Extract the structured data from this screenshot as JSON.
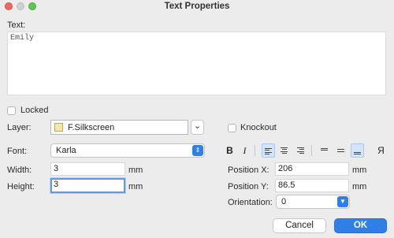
{
  "window": {
    "title": "Text Properties"
  },
  "text_section": {
    "label": "Text:",
    "value": "Emily"
  },
  "locked": {
    "label": "Locked",
    "checked": false
  },
  "layer": {
    "label": "Layer:",
    "value": "F.Silkscreen",
    "swatch_color": "#f5e7a6"
  },
  "knockout": {
    "label": "Knockout",
    "checked": false
  },
  "font": {
    "label": "Font:",
    "value": "Karla"
  },
  "format_toolbar": {
    "bold": "B",
    "italic": "I",
    "mirror": "Я",
    "icons": [
      "align-left-icon",
      "align-center-icon",
      "align-right-icon",
      "valign-top-icon",
      "valign-middle-icon",
      "valign-bottom-icon"
    ],
    "active": [
      "align-left",
      "valign-bottom"
    ],
    "accent_color": "#d3e5fb"
  },
  "width": {
    "label": "Width:",
    "value": "3",
    "unit": "mm"
  },
  "height": {
    "label": "Height:",
    "value": "3",
    "unit": "mm"
  },
  "position_x": {
    "label": "Position X:",
    "value": "206",
    "unit": "mm"
  },
  "position_y": {
    "label": "Position Y:",
    "value": "86.5",
    "unit": "mm"
  },
  "orientation": {
    "label": "Orientation:",
    "value": "0"
  },
  "buttons": {
    "cancel": "Cancel",
    "ok": "OK"
  },
  "colors": {
    "ok_button": "#2f7fe6",
    "close": "#ed6a5e",
    "maximize": "#61c554"
  }
}
